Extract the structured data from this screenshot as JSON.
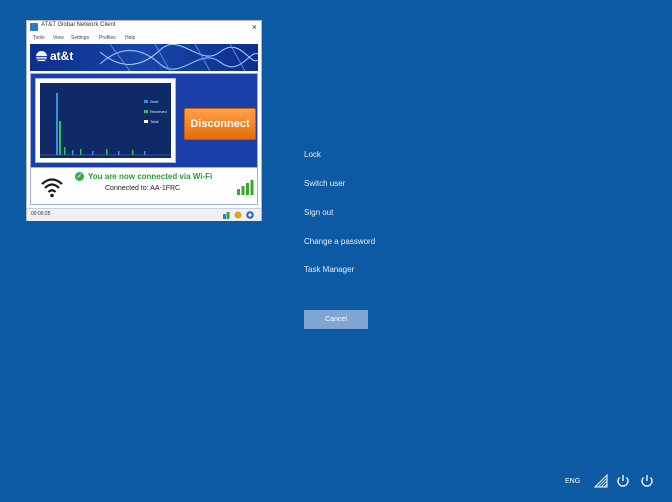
{
  "window": {
    "title": "AT&T Global Network Client",
    "menu": [
      "Tools",
      "View",
      "Settings",
      "Profiles",
      "Help"
    ],
    "brand": "at&t",
    "disconnect_label": "Disconnect",
    "legend": [
      "Sent",
      "Received",
      "Total"
    ],
    "status_main": "You are now connected via Wi-Fi",
    "status_sub": "Connected to: AA-1FRC",
    "statusbar_text": "00:00:25"
  },
  "security_menu": {
    "items": [
      "Lock",
      "Switch user",
      "Sign out",
      "Change a password",
      "Task Manager"
    ],
    "cancel_label": "Cancel"
  },
  "tray": {
    "language": "ENG"
  },
  "colors": {
    "background": "#0d5aa4",
    "disconnect": "#f08a26",
    "connected_text": "#2a9c3c"
  }
}
